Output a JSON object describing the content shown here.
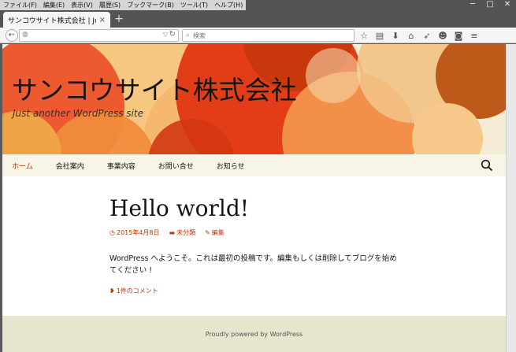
{
  "menubar": {
    "items": [
      "ファイル(F)",
      "編集(E)",
      "表示(V)",
      "履歴(S)",
      "ブックマーク(B)",
      "ツール(T)",
      "ヘルプ(H)"
    ]
  },
  "window_controls": {
    "minimize": "─",
    "maximize": "□",
    "close": "✕"
  },
  "tab": {
    "title": "サンコウサイト株式会社 | Just a...",
    "close": "×",
    "new_tab": "+"
  },
  "navbar": {
    "back": "←",
    "url": "",
    "search_placeholder": "検索",
    "icons": [
      "star-icon",
      "reading-list-icon",
      "download-icon",
      "home-icon",
      "share-icon",
      "emoji-icon",
      "camera-icon",
      "hamburger-menu-icon"
    ]
  },
  "site": {
    "title": "サンコウサイト株式会社",
    "description": "Just another WordPress site",
    "nav": [
      "ホーム",
      "会社案内",
      "事業内容",
      "お問い合せ",
      "お知らせ"
    ],
    "active_nav": "ホーム",
    "accent_color": "#bc360a"
  },
  "post": {
    "title": "Hello world!",
    "date": "2015年4月8日",
    "category": "未分類",
    "edit": "編集",
    "body": "WordPress へようこそ。これは最初の投稿です。編集もしくは削除してブログを始めてください !",
    "comments": "1件のコメント"
  },
  "footer": {
    "text": "Proudly powered by WordPress"
  }
}
